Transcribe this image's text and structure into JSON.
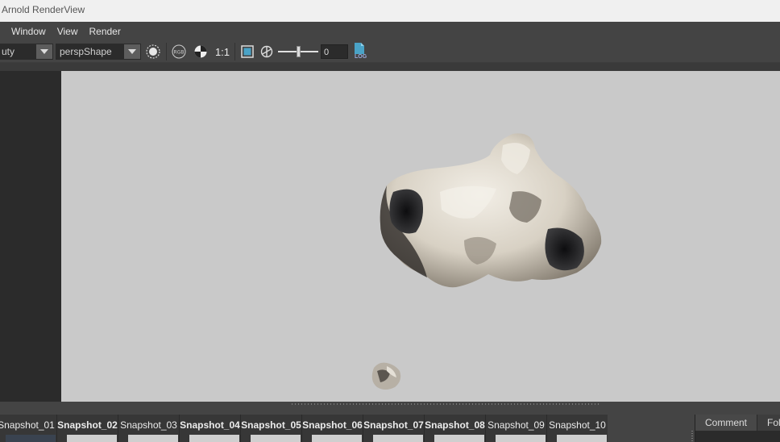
{
  "window": {
    "title": "Arnold RenderView"
  },
  "menu": {
    "items": [
      "Window",
      "View",
      "Render"
    ]
  },
  "toolbar": {
    "aov_value": "uty",
    "camera_value": "perspShape",
    "ratio_label": "1:1",
    "exposure_value": "0",
    "exposure_slider": 0.5,
    "log_label": "LOG",
    "rgb_label": "RGB"
  },
  "snapshots": [
    {
      "name": "Snapshot_01",
      "bold": false,
      "thumb": "dark"
    },
    {
      "name": "Snapshot_02",
      "bold": true,
      "thumb": "light"
    },
    {
      "name": "Snapshot_03",
      "bold": false,
      "thumb": "light"
    },
    {
      "name": "Snapshot_04",
      "bold": true,
      "thumb": "light"
    },
    {
      "name": "Snapshot_05",
      "bold": true,
      "thumb": "light"
    },
    {
      "name": "Snapshot_06",
      "bold": true,
      "thumb": "light"
    },
    {
      "name": "Snapshot_07",
      "bold": true,
      "thumb": "light"
    },
    {
      "name": "Snapshot_08",
      "bold": true,
      "thumb": "light"
    },
    {
      "name": "Snapshot_09",
      "bold": false,
      "thumb": "light"
    },
    {
      "name": "Snapshot_10",
      "bold": false,
      "thumb": "light"
    }
  ],
  "side_tabs": [
    "Comment",
    "Fold"
  ],
  "colors": {
    "viewport_bg": "#c9c9c9",
    "panel_bg": "#444444",
    "accent": "#4aa3c7"
  }
}
